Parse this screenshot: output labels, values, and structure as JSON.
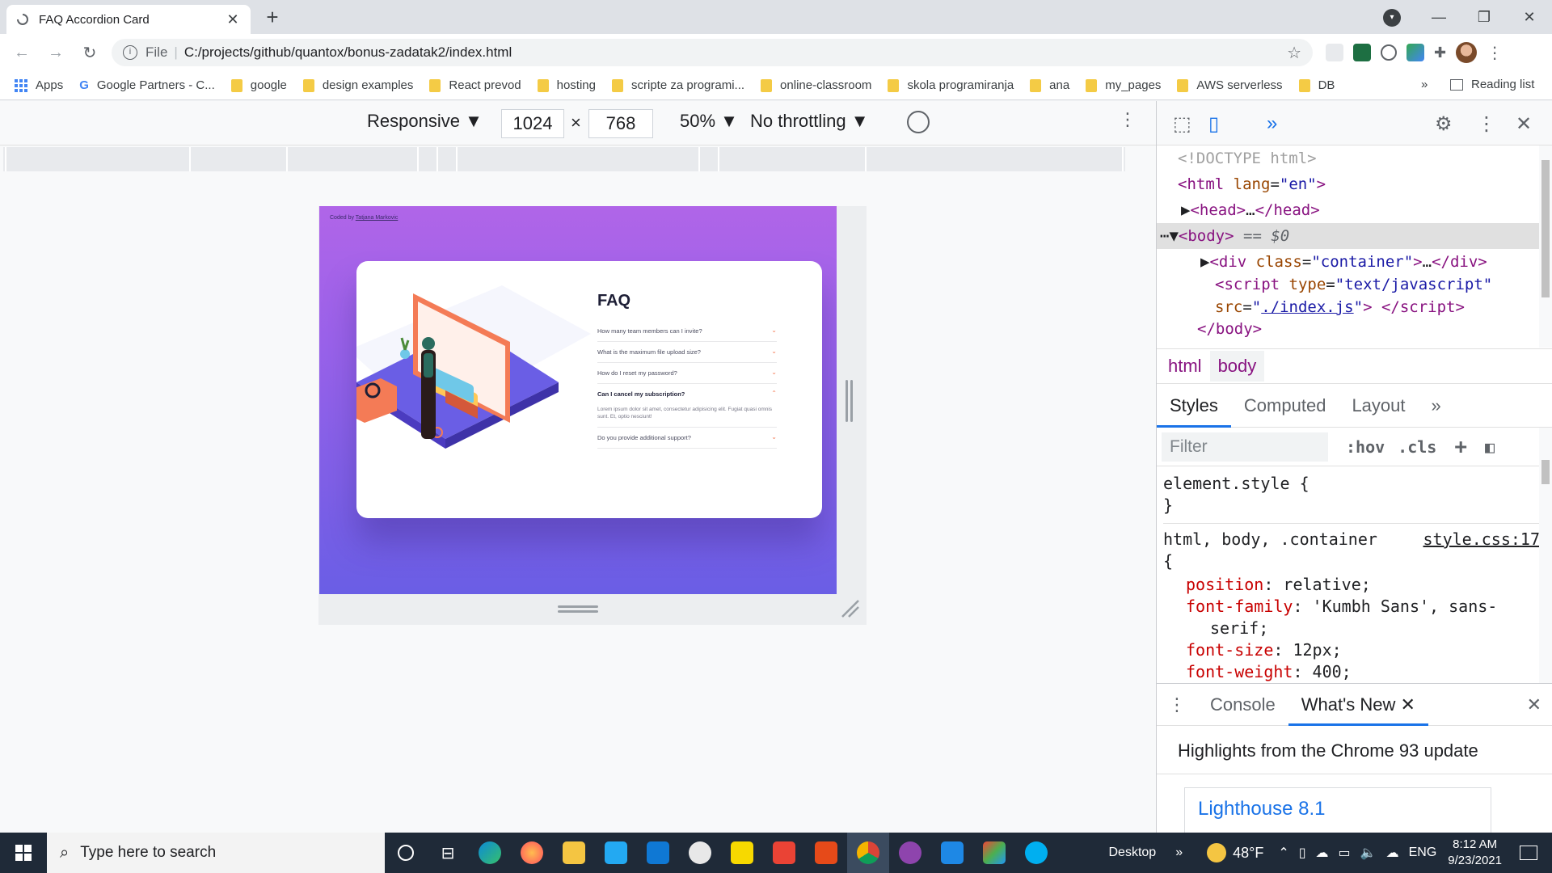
{
  "browser": {
    "tab_title": "FAQ Accordion Card",
    "new_tab": "+",
    "close": "✕",
    "url_scheme": "File",
    "url": "C:/projects/github/quantox/bonus-zadatak2/index.html"
  },
  "bookmarks": {
    "items": [
      "Apps",
      "Google Partners - C...",
      "google",
      "design examples",
      "React prevod",
      "hosting",
      "scripte za programi...",
      "online-classroom",
      "skola programiranja",
      "ana",
      "my_pages",
      "AWS serverless",
      "DB"
    ],
    "more": "»",
    "reading_list": "Reading list"
  },
  "device_toolbar": {
    "mode": "Responsive",
    "width": "1024",
    "times": "×",
    "height": "768",
    "zoom": "50%",
    "throttling": "No throttling"
  },
  "page": {
    "coded_by": "Coded by ",
    "author": "Tatjana Markovic",
    "faq_title": "FAQ",
    "questions": [
      {
        "q": "How many team members can I invite?",
        "open": false
      },
      {
        "q": "What is the maximum file upload size?",
        "open": false
      },
      {
        "q": "How do I reset my password?",
        "open": false
      },
      {
        "q": "Can I cancel my subscription?",
        "open": true,
        "a": "Lorem ipsum dolor sit amet, consectetur adipisicing elit. Fugiat quasi omnis sunt. Et, optio nesciunt!"
      },
      {
        "q": "Do you provide additional support?",
        "open": false
      }
    ]
  },
  "devtools": {
    "elements": {
      "doctype": "<!DOCTYPE html>",
      "html_open_tag": "html",
      "html_attr": "lang",
      "html_attr_val": "\"en\"",
      "head": "head",
      "body": "body",
      "eq": "== $0",
      "div_class_val": "\"container\"",
      "script_type_val": "\"text/javascript\"",
      "script_src_val": "./index.js",
      "ellipsis": "…"
    },
    "crumbs": [
      "html",
      "body"
    ],
    "style_tabs": [
      "Styles",
      "Computed",
      "Layout",
      "»"
    ],
    "filter_placeholder": "Filter",
    "hov": ":hov",
    "cls": ".cls",
    "element_style": "element.style {",
    "rule_selector": "html, body, .container",
    "rule_source": "style.css:17",
    "props": [
      {
        "name": "position",
        "value": "relative;"
      },
      {
        "name": "font-family",
        "value": "'Kumbh Sans', sans-"
      },
      {
        "name": "",
        "value": "serif;"
      },
      {
        "name": "font-size",
        "value": "12px;"
      },
      {
        "name": "font-weight",
        "value": "400;"
      }
    ],
    "drawer_tabs": [
      "Console",
      "What's New"
    ],
    "highlights": "Highlights from the Chrome 93 update",
    "lighthouse": "Lighthouse 8.1"
  },
  "taskbar": {
    "search_placeholder": "Type here to search",
    "desktop": "Desktop",
    "temp": "48°F",
    "lang": "ENG",
    "time": "8:12 AM",
    "date": "9/23/2021"
  },
  "colors": {
    "page_gradient_top": "#b065e8",
    "page_gradient_bottom": "#6a5ee5",
    "accent_orange": "#f47b56",
    "devtools_blue": "#1a73e8"
  }
}
